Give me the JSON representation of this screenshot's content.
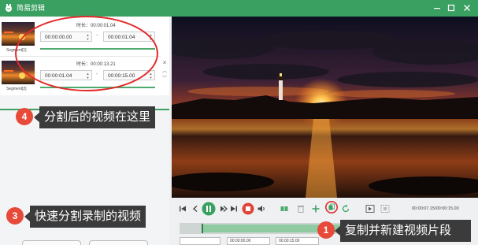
{
  "window": {
    "title": "简易剪辑"
  },
  "segments": [
    {
      "name": "Segment[1]",
      "duration_label": "时长：00:00:01.04",
      "start": "00:00:00.00",
      "end": "00:00:01.04"
    },
    {
      "name": "Segment[2]",
      "duration_label": "时长：00:00:13.21",
      "start": "00:00:01.04",
      "end": "00:00:15.00"
    }
  ],
  "annotations": [
    {
      "num": "4",
      "text": "分割后的视频在这里"
    },
    {
      "num": "3",
      "text": "快速分割录制的视频"
    },
    {
      "num": "1",
      "text": "复制并新建视频片段"
    }
  ],
  "playback": {
    "time_readout": "00:00:07.15/00:00:15.00"
  },
  "bottom": {
    "field1": "00:00:00.00",
    "field2": "00:00:15.00"
  },
  "colors": {
    "accent": "#3aa061",
    "annotation_bg": "#3b3b3b",
    "badge": "#e84a3a",
    "highlight_ring": "#e32b2b"
  },
  "icons": [
    "app-logo-icon",
    "minimize-icon",
    "maximize-icon",
    "close-icon",
    "skip-start-icon",
    "prev-frame-icon",
    "pause-icon",
    "next-frame-icon",
    "skip-end-icon",
    "stop-icon",
    "volume-icon",
    "split-icon",
    "delete-icon",
    "add-icon",
    "copy-segment-icon",
    "reset-icon",
    "mark-in-icon",
    "mark-out-icon"
  ]
}
